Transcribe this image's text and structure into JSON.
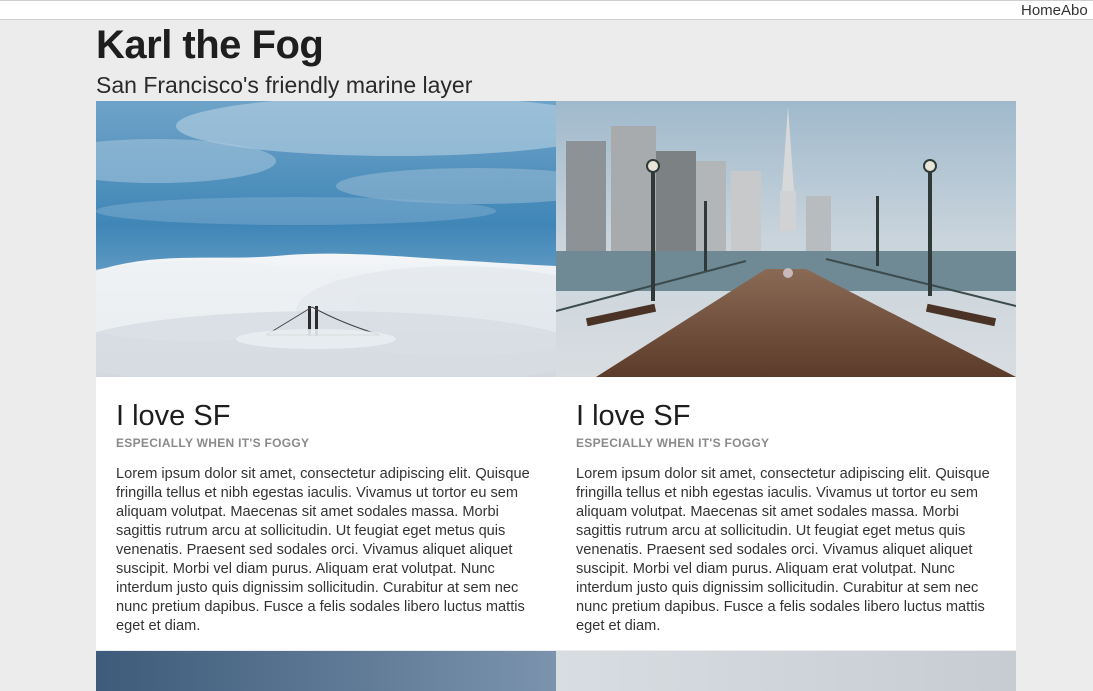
{
  "nav": {
    "items": [
      "Home",
      "Abo"
    ]
  },
  "site": {
    "title": "Karl the Fog",
    "subtitle": "San Francisco's friendly marine layer"
  },
  "cards": [
    {
      "image": "fog-over-golden-gate-bridge",
      "title": "I love SF",
      "kicker": "ESPECIALLY WHEN IT'S FOGGY",
      "text": "Lorem ipsum dolor sit amet, consectetur adipiscing elit. Quisque fringilla tellus et nibh egestas iaculis. Vivamus ut tortor eu sem aliquam volutpat. Maecenas sit amet sodales massa. Morbi sagittis rutrum arcu at sollicitudin. Ut feugiat eget metus quis venenatis. Praesent sed sodales orci. Vivamus aliquet aliquet suscipit. Morbi vel diam purus. Aliquam erat volutpat. Nunc interdum justo quis dignissim sollicitudin. Curabitur at sem nec nunc pretium dapibus. Fusce a felis sodales libero luctus mattis eget et diam."
    },
    {
      "image": "pier-with-skyline",
      "title": "I love SF",
      "kicker": "ESPECIALLY WHEN IT'S FOGGY",
      "text": "Lorem ipsum dolor sit amet, consectetur adipiscing elit. Quisque fringilla tellus et nibh egestas iaculis. Vivamus ut tortor eu sem aliquam volutpat. Maecenas sit amet sodales massa. Morbi sagittis rutrum arcu at sollicitudin. Ut feugiat eget metus quis venenatis. Praesent sed sodales orci. Vivamus aliquet aliquet suscipit. Morbi vel diam purus. Aliquam erat volutpat. Nunc interdum justo quis dignissim sollicitudin. Curabitur at sem nec nunc pretium dapibus. Fusce a felis sodales libero luctus mattis eget et diam."
    }
  ]
}
